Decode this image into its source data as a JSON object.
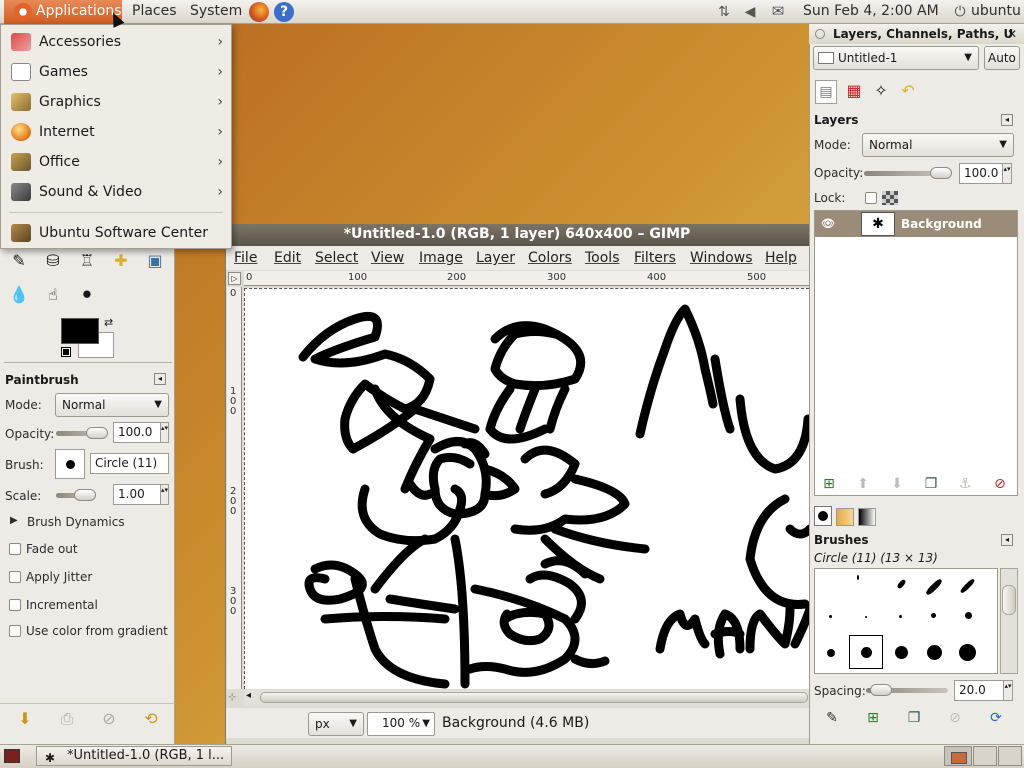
{
  "top_panel": {
    "menus": [
      "Applications",
      "Places",
      "System"
    ],
    "clock": "Sun Feb  4,  2:00 AM",
    "user": "ubuntu"
  },
  "app_menu": {
    "items": [
      {
        "label": "Accessories",
        "icon": "accessories-icon"
      },
      {
        "label": "Games",
        "icon": "games-icon"
      },
      {
        "label": "Graphics",
        "icon": "graphics-icon"
      },
      {
        "label": "Internet",
        "icon": "internet-icon"
      },
      {
        "label": "Office",
        "icon": "office-icon"
      },
      {
        "label": "Sound & Video",
        "icon": "sound-video-icon"
      }
    ],
    "software_center": "Ubuntu Software Center"
  },
  "toolbox": {
    "tool_options_title": "Paintbrush",
    "mode_label": "Mode:",
    "mode_value": "Normal",
    "opacity_label": "Opacity:",
    "opacity_value": "100.0",
    "brush_label": "Brush:",
    "brush_value": "Circle (11)",
    "scale_label": "Scale:",
    "scale_value": "1.00",
    "brush_dynamics": "Brush Dynamics",
    "fade_out": "Fade out",
    "apply_jitter": "Apply Jitter",
    "incremental": "Incremental",
    "use_gradient": "Use color from gradient"
  },
  "image_window": {
    "title": "*Untitled-1.0 (RGB, 1 layer) 640x400 – GIMP",
    "menus": [
      "File",
      "Edit",
      "Select",
      "View",
      "Image",
      "Layer",
      "Colors",
      "Tools",
      "Filters",
      "Windows",
      "Help"
    ],
    "ruler_h": [
      "0",
      "100",
      "200",
      "300",
      "400",
      "500"
    ],
    "ruler_v": [
      "0",
      "100",
      "200",
      "300"
    ],
    "unit": "px",
    "zoom": "100 %",
    "status": "Background (4.6 MB)",
    "canvas_text": [
      "MU",
      "MAN"
    ]
  },
  "layers_dock": {
    "title": "Layers, Channels, Paths, U",
    "image_select": "Untitled-1",
    "auto_button": "Auto",
    "layers_header": "Layers",
    "mode_label": "Mode:",
    "mode_value": "Normal",
    "opacity_label": "Opacity:",
    "opacity_value": "100.0",
    "lock_label": "Lock:",
    "layer_name": "Background",
    "brushes_header": "Brushes",
    "brush_info": "Circle (11) (13 × 13)",
    "spacing_label": "Spacing:",
    "spacing_value": "20.0"
  },
  "taskbar": {
    "task_label": "*Untitled-1.0 (RGB, 1 l..."
  },
  "colors": {
    "panel_menu_active": "#d8672d",
    "layer_selected": "#9a8c79",
    "title_bar": "#6a6357"
  }
}
